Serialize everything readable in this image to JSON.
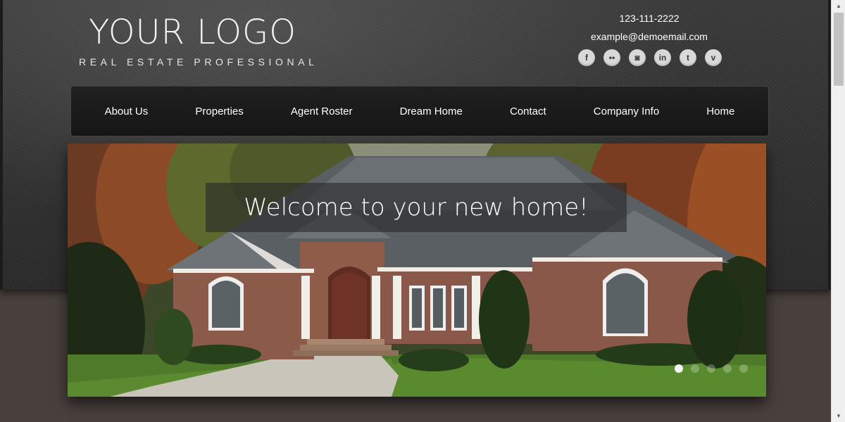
{
  "header": {
    "logo_title": "YOUR LOGO",
    "logo_subtitle": "REAL ESTATE PROFESSIONAL",
    "phone": "123-111-2222",
    "email": "example@demoemail.com",
    "social": [
      {
        "name": "facebook-icon",
        "glyph": "f"
      },
      {
        "name": "flickr-icon",
        "glyph": "••"
      },
      {
        "name": "instagram-icon",
        "glyph": "◙"
      },
      {
        "name": "linkedin-icon",
        "glyph": "in"
      },
      {
        "name": "twitter-icon",
        "glyph": "t"
      },
      {
        "name": "vimeo-icon",
        "glyph": "v"
      }
    ]
  },
  "nav": {
    "items": [
      "About Us",
      "Properties",
      "Agent Roster",
      "Dream Home",
      "Contact",
      "Company Info",
      "Home"
    ]
  },
  "hero": {
    "caption": "Welcome to your new home!",
    "slides": 5,
    "active_slide": 0
  },
  "colors": {
    "accent_background": "#2a2a2a",
    "body_background": "#48403d"
  }
}
